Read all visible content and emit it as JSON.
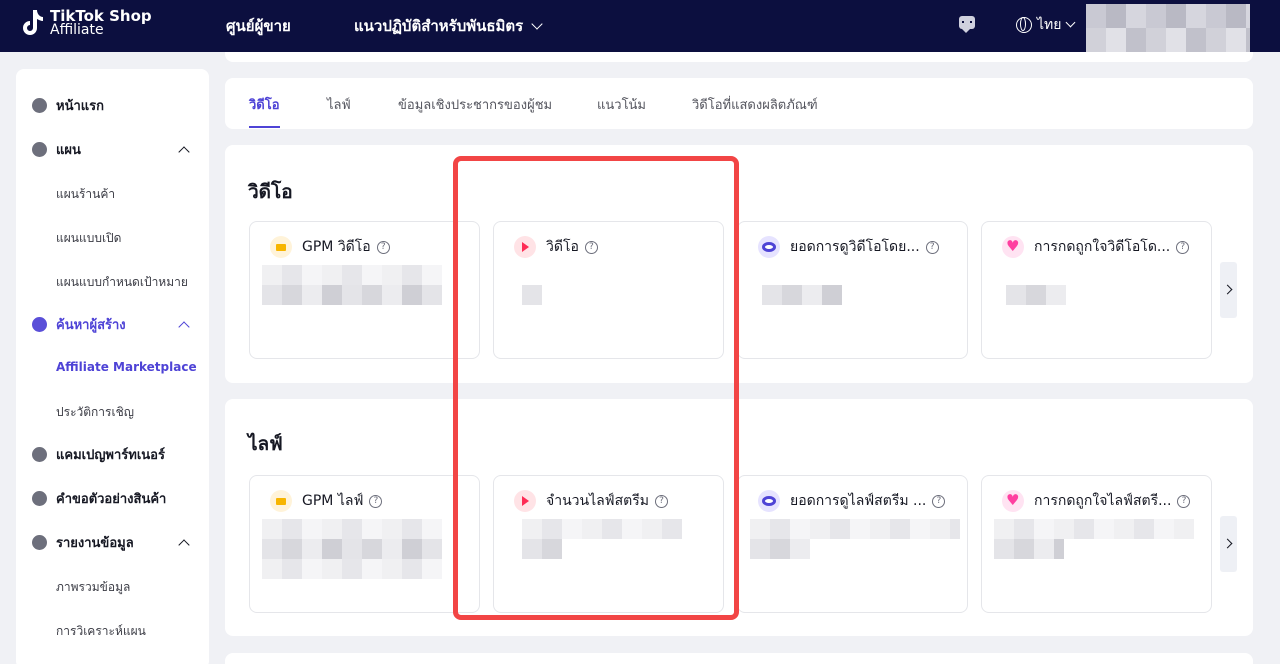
{
  "header": {
    "logo_line1": "TikTok Shop",
    "logo_line2": "Affiliate",
    "seller_center": "ศูนย์ผู้ขาย",
    "partner_guide": "แนวปฏิบัติสำหรับพันธมิตร",
    "language": "ไทย"
  },
  "sidebar": {
    "home": "หน้าแรก",
    "plans": "แผน",
    "plan_shop": "แผนร้านค้า",
    "plan_open": "แผนแบบเปิด",
    "plan_targeted": "แผนแบบกำหนดเป้าหมาย",
    "find_creators": "ค้นหาผู้สร้าง",
    "affiliate_marketplace": "Affiliate Marketplace",
    "invite_history": "ประวัติการเชิญ",
    "partner_campaigns": "แคมเปญพาร์ทเนอร์",
    "sample_requests": "คำขอตัวอย่างสินค้า",
    "data_reports": "รายงานข้อมูล",
    "data_overview": "ภาพรวมข้อมูล",
    "plan_analysis": "การวิเคราะห์แผน"
  },
  "tabs": [
    "วิดีโอ",
    "ไลฟ์",
    "ข้อมูลเชิงประชากรของผู้ชม",
    "แนวโน้ม",
    "วิดีโอที่แสดงผลิตภัณฑ์"
  ],
  "video_section": {
    "title": "วิดีโอ",
    "cards": [
      "GPM วิดีโอ",
      "วิดีโอ",
      "ยอดการดูวิดีโอโดย...",
      "การกดถูกใจวิดีโอโด..."
    ]
  },
  "live_section": {
    "title": "ไลฟ์",
    "cards": [
      "GPM ไลฟ์",
      "จำนวนไลฟ์สตรีม",
      "ยอดการดูไลฟ์สตรีม ...",
      "การกดถูกใจไลฟ์สตรี..."
    ]
  },
  "colors": {
    "header_bg": "#0c0f3f",
    "accent": "#4e43d6",
    "highlight": "#f24545"
  }
}
